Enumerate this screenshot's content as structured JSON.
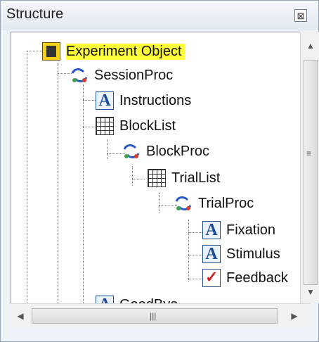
{
  "panel": {
    "title": "Structure",
    "close_label": "⊠"
  },
  "tree": {
    "items": [
      {
        "label": "Experiment Object",
        "icon": "experiment-icon",
        "selected": true
      },
      {
        "label": "SessionProc",
        "icon": "procedure-icon"
      },
      {
        "label": "Instructions",
        "icon": "text-display-icon"
      },
      {
        "label": "BlockList",
        "icon": "list-icon"
      },
      {
        "label": "BlockProc",
        "icon": "procedure-icon"
      },
      {
        "label": "TrialList",
        "icon": "list-icon"
      },
      {
        "label": "TrialProc",
        "icon": "procedure-icon"
      },
      {
        "label": "Fixation",
        "icon": "text-display-icon"
      },
      {
        "label": "Stimulus",
        "icon": "text-display-icon"
      },
      {
        "label": "Feedback",
        "icon": "feedback-icon"
      },
      {
        "label": "GoodBye",
        "icon": "text-display-icon"
      }
    ]
  },
  "colors": {
    "selection_highlight": "#ffff3a",
    "accent": "#1d4b9a"
  }
}
